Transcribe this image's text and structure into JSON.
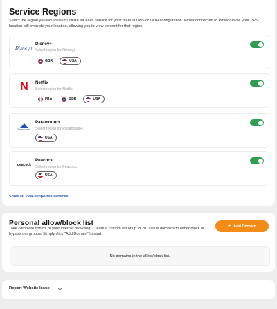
{
  "regions": {
    "title": "Service Regions",
    "description": "Select the region you would like to utilize for each service for your manual DNS or DOH configuration. When connected to PrivadoVPN, your VPN location will override your location, allowing you to view content for that region.",
    "show_all_label": "Show all VPN-supported services →",
    "services": [
      {
        "name": "Disney+",
        "hint": "Select region for Disney+.",
        "logo_text": "Disney+",
        "enabled": true,
        "regions": [
          {
            "code": "GBR",
            "flag": "uk-flag-icon",
            "selected": false
          },
          {
            "code": "USA",
            "flag": "us-flag-icon",
            "selected": true
          }
        ]
      },
      {
        "name": "Netflix",
        "hint": "Select region for Netflix.",
        "logo_text": "N",
        "enabled": true,
        "regions": [
          {
            "code": "FRA",
            "flag": "fr-flag-icon",
            "selected": false
          },
          {
            "code": "GBR",
            "flag": "uk-flag-icon",
            "selected": false
          },
          {
            "code": "USA",
            "flag": "us-flag-icon",
            "selected": true
          }
        ]
      },
      {
        "name": "Paramount+",
        "hint": "Select region for Paramount+.",
        "logo_text": "Paramount+",
        "enabled": true,
        "regions": [
          {
            "code": "USA",
            "flag": "us-flag-icon",
            "selected": true
          }
        ]
      },
      {
        "name": "Peacock",
        "hint": "Select region for Peacock.",
        "logo_text": "peacock",
        "enabled": true,
        "regions": [
          {
            "code": "USA",
            "flag": "us-flag-icon",
            "selected": true
          }
        ]
      }
    ]
  },
  "allowlist": {
    "title": "Personal allow/block list",
    "description": "Take complete control of your Internet browsing! Create a custom list of up to 20 unique domains to either block or bypass our groups. Simply click \"Add Domain\" to start.",
    "add_button_label": "Add Domain",
    "empty_text": "No domains in the allow/block list."
  },
  "report": {
    "label": "Report Website Issue"
  },
  "colors": {
    "toggle_on": "#2e9e54",
    "accent_orange": "#f28c17",
    "link_blue": "#2a5eb0",
    "netflix_red": "#e50914"
  }
}
